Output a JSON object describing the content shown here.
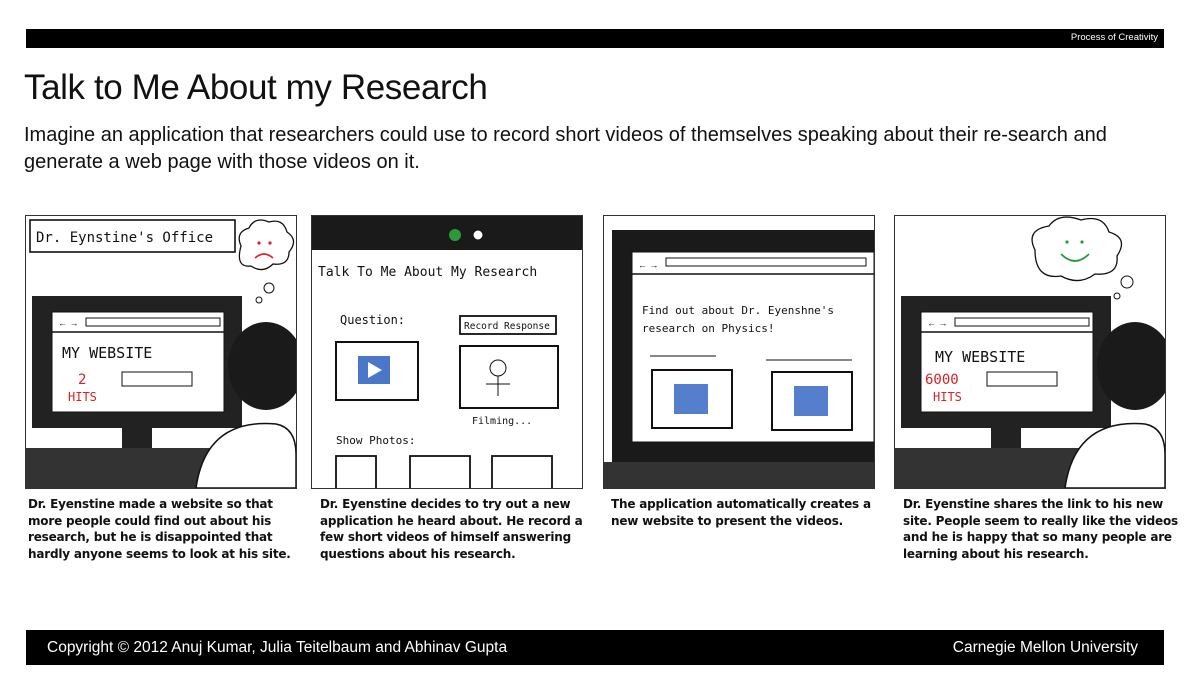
{
  "header": {
    "section_label": "Process of Creativity"
  },
  "slide": {
    "title": "Talk to Me About my Research",
    "subtitle": "Imagine an application that researchers could use to record short videos of themselves speaking about their re-search and generate a web page with those videos on it."
  },
  "panels": [
    {
      "sketch_text": {
        "office_sign": "Dr. Eynstine's Office",
        "site_title": "MY  WEBSITE",
        "hits_count": "2",
        "hits_label": "HITS"
      },
      "caption": "Dr. Eyenstine made a website so that more people could find out about his research, but he is disappointed that hardly anyone seems to look at his site."
    },
    {
      "sketch_text": {
        "app_title": "Talk To Me About My Research",
        "question_label": "Question:",
        "record_button": "Record Response",
        "filming_label": "Filming...",
        "photos_label": "Show Photos:"
      },
      "caption": "Dr. Eyenstine decides to try out a new application he heard about. He record a few short videos of himself answering questions about his research."
    },
    {
      "sketch_text": {
        "page_heading_line1": "Find out about Dr. Eyenshne's",
        "page_heading_line2": "research on Physics!"
      },
      "caption": "The application automatically creates a new website to present the videos."
    },
    {
      "sketch_text": {
        "site_title": "MY  WEBSITE",
        "hits_count": "6000",
        "hits_label": "HITS"
      },
      "caption": "Dr. Eyenstine shares the link to his new site. People seem to really like the videos and he is happy that so many people are learning about his research."
    }
  ],
  "footer": {
    "copyright": "Copyright © 2012 Anuj Kumar, Julia Teitelbaum and Abhinav Gupta",
    "institution": "Carnegie Mellon University"
  },
  "colors": {
    "bar": "#000000",
    "ink": "#111111",
    "hits_red": "#d8222a",
    "video_blue": "#2b5fbf",
    "happy_green": "#2a9a3a"
  }
}
